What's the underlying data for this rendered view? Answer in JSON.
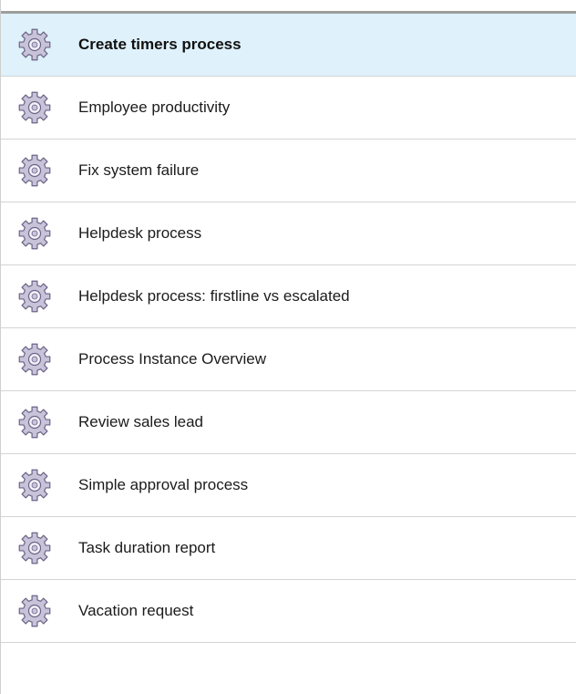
{
  "process_list": {
    "selected_index": 0,
    "items": [
      {
        "label": "Create timers process",
        "icon": "gear-icon"
      },
      {
        "label": "Employee productivity",
        "icon": "gear-icon"
      },
      {
        "label": "Fix system failure",
        "icon": "gear-icon"
      },
      {
        "label": "Helpdesk process",
        "icon": "gear-icon"
      },
      {
        "label": "Helpdesk process: firstline vs escalated",
        "icon": "gear-icon"
      },
      {
        "label": "Process Instance Overview",
        "icon": "gear-icon"
      },
      {
        "label": "Review sales lead",
        "icon": "gear-icon"
      },
      {
        "label": "Simple approval process",
        "icon": "gear-icon"
      },
      {
        "label": "Task duration report",
        "icon": "gear-icon"
      },
      {
        "label": "Vacation request",
        "icon": "gear-icon"
      }
    ]
  },
  "colors": {
    "selected_row_bg": "#dff1fb",
    "divider": "#d4d4d4",
    "gear_fill": "#c8c3d8",
    "gear_stroke": "#6a6488"
  }
}
